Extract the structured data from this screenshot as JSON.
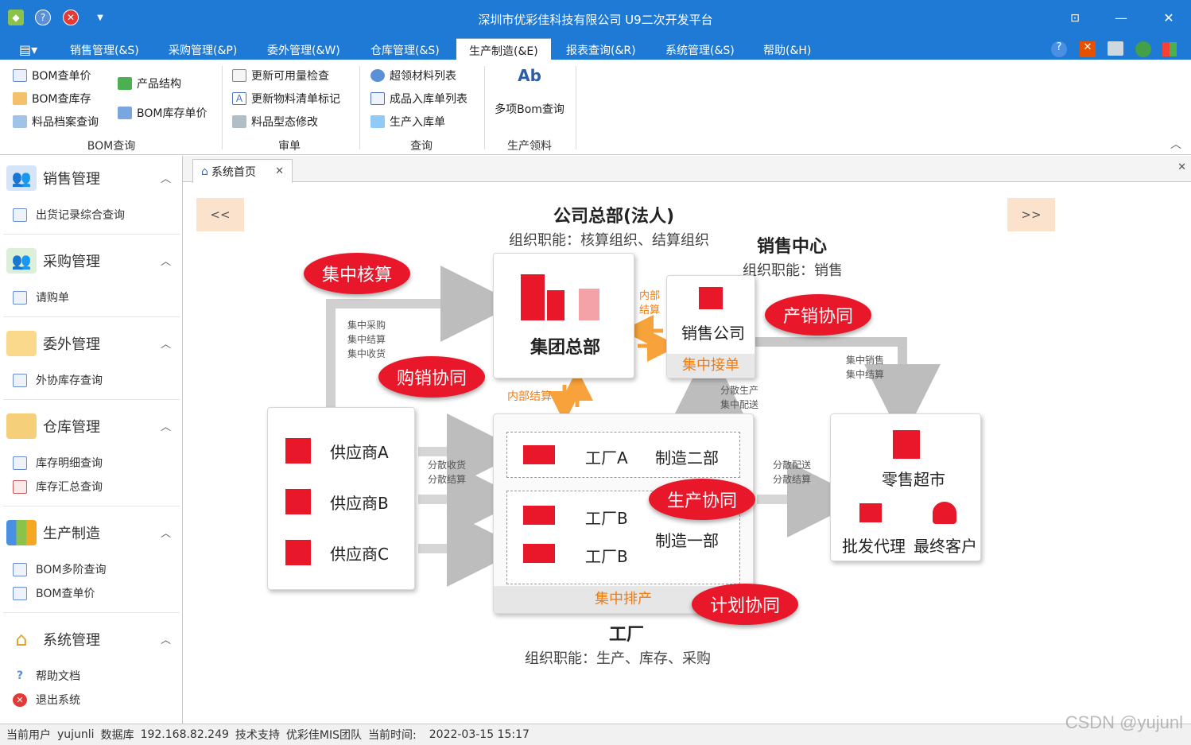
{
  "window": {
    "title": "深圳市优彩佳科技有限公司 U9二次开发平台"
  },
  "menu": {
    "tabs": [
      "销售管理(&S)",
      "采购管理(&P)",
      "委外管理(&W)",
      "仓库管理(&S)",
      "生产制造(&E)",
      "报表查询(&R)",
      "系统管理(&S)",
      "帮助(&H)"
    ],
    "active": "生产制造(&E)"
  },
  "ribbon": {
    "bom": {
      "b1": "BOM查单价",
      "b2": "BOM查库存",
      "b3": "料品档案查询",
      "b4": "产品结构",
      "b5": "BOM库存单价",
      "label": "BOM查询"
    },
    "audit": {
      "b1": "更新可用量检查",
      "b2": "更新物料清单标记",
      "b3": "料品型态修改",
      "label": "审单"
    },
    "query": {
      "b1": "超领材料列表",
      "b2": "成品入库单列表",
      "b3": "生产入库单",
      "label": "查询"
    },
    "issue": {
      "b1": "多项Bom查询",
      "label": "生产领料",
      "icon_text": "Ab"
    }
  },
  "sidebar": {
    "sales": {
      "title": "销售管理",
      "items": [
        "出货记录综合查询"
      ]
    },
    "purchase": {
      "title": "采购管理",
      "items": [
        "请购单"
      ]
    },
    "outsource": {
      "title": "委外管理",
      "items": [
        "外协库存查询"
      ]
    },
    "warehouse": {
      "title": "仓库管理",
      "items": [
        "库存明细查询",
        "库存汇总查询"
      ]
    },
    "production": {
      "title": "生产制造",
      "items": [
        "BOM多阶查询",
        "BOM查单价"
      ]
    },
    "system": {
      "title": "系统管理",
      "items": [
        "帮助文档",
        "退出系统"
      ]
    }
  },
  "tab": {
    "home": "系统首页"
  },
  "diagram": {
    "prev": "<<",
    "next": ">>",
    "hq_title": "公司总部(法人)",
    "hq_func": "组织职能：核算组织、结算组织",
    "group_hq": "集团总部",
    "sales_center": "销售中心",
    "sales_func": "组织职能：销售",
    "sales_company": "销售公司",
    "order_center": "集中接单",
    "internal_settle_v": "内部\n结算",
    "internal_settle": "内部结算",
    "central_purchase": "集中采购\n集中结算\n集中收货",
    "central_sales": "集中销售\n集中结算",
    "dist_prod": "分散生产\n集中配送",
    "dist_receive": "分散收货\n分散结算",
    "dist_deliver": "分散配送\n分散结算",
    "suppliers": [
      "供应商A",
      "供应商B",
      "供应商C"
    ],
    "factory_a": "工厂A",
    "dept2": "制造二部",
    "factory_b1": "工厂B",
    "factory_b2": "工厂B",
    "dept1": "制造一部",
    "scheduling": "集中排产",
    "factory_title": "工厂",
    "factory_func": "组织职能：生产、库存、采购",
    "retail": "零售超市",
    "wholesale": "批发代理",
    "customer": "最终客户",
    "bubbles": {
      "accounting": "集中核算",
      "purchase_sales": "购销协同",
      "prod_sales": "产销协同",
      "production": "生产协同",
      "planning": "计划协同"
    }
  },
  "status": {
    "user_label": "当前用户",
    "user": "yujunli",
    "db_label": "数据库",
    "db": "192.168.82.249",
    "support_label": "技术支持",
    "support": "优彩佳MIS团队",
    "time_label": "当前时间:",
    "time": "2022-03-15 15:17"
  },
  "watermark": "CSDN @yujunl"
}
